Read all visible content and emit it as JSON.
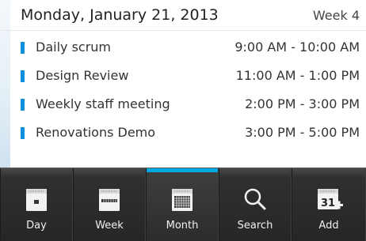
{
  "header": {
    "date": "Monday, January 21, 2013",
    "week": "Week 4"
  },
  "events": [
    {
      "title": "Daily scrum",
      "time": "9:00 AM - 10:00 AM"
    },
    {
      "title": "Design Review",
      "time": "11:00 AM - 1:00 PM"
    },
    {
      "title": "Weekly staff meeting",
      "time": "2:00 PM - 3:00 PM"
    },
    {
      "title": "Renovations Demo",
      "time": "3:00 PM - 5:00 PM"
    }
  ],
  "tabs": [
    {
      "label": "Day",
      "icon": "calendar-day-icon"
    },
    {
      "label": "Week",
      "icon": "calendar-week-icon"
    },
    {
      "label": "Month",
      "icon": "calendar-month-icon",
      "active": true
    },
    {
      "label": "Search",
      "icon": "search-icon"
    },
    {
      "label": "Add",
      "icon": "calendar-add-icon",
      "badge": "31"
    }
  ],
  "colors": {
    "accent": "#00a8df",
    "event_marker": "#0a8fdc",
    "tabbar": "#262626"
  }
}
